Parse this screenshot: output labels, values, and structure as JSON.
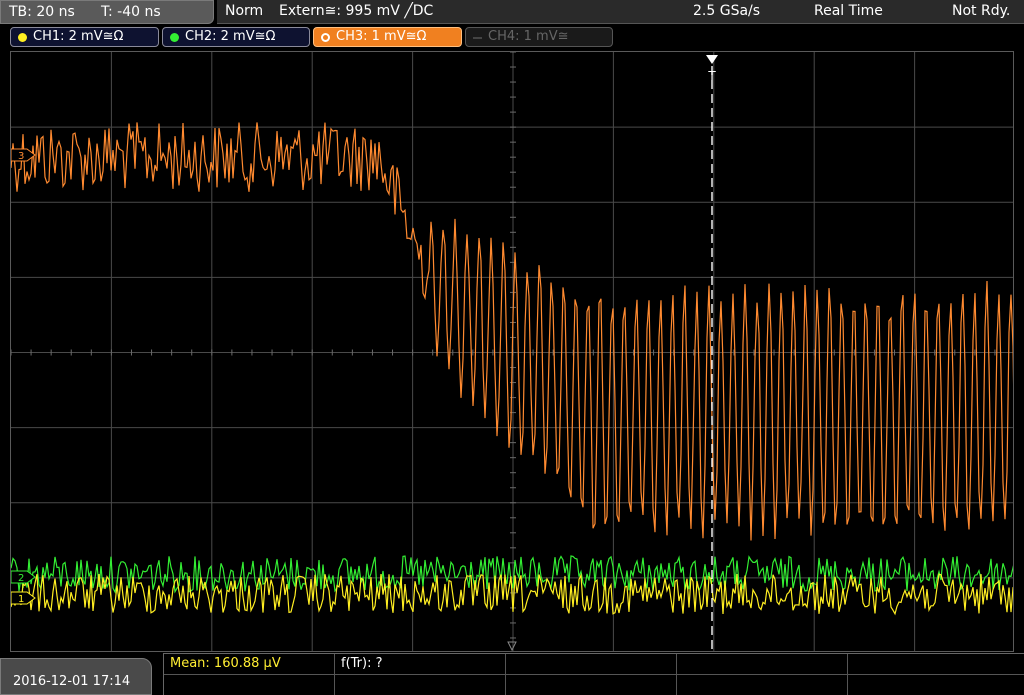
{
  "topbar": {
    "timebase": "TB: 20 ns",
    "trigger_offset": "T: -40 ns",
    "mode": "Norm",
    "trigger_source": "Extern≅: 995 mV ╱DC",
    "sample_rate": "2.5 GSa/s",
    "acq_mode": "Real Time",
    "status": "Not Rdy."
  },
  "channels": [
    {
      "label": "CH1: 2 mV≅Ω",
      "color": "#ffee22",
      "state": "on"
    },
    {
      "label": "CH2: 2 mV≅Ω",
      "color": "#33ee33",
      "state": "on"
    },
    {
      "label": "CH3: 1 mV≅Ω",
      "color": "#ff8a30",
      "state": "active"
    },
    {
      "label": "CH4: 1 mV≅",
      "color": "#666666",
      "state": "off"
    }
  ],
  "markers": {
    "ch3": "3",
    "ch2": "2",
    "ch1": "1",
    "trigger": "T"
  },
  "measurements": {
    "mean_label": "Mean: 160.88 µV",
    "freq_label": "f(Tr): ?"
  },
  "datetime": "2016-12-01 17:14",
  "colors": {
    "ch1": "#ffee22",
    "ch2": "#33ee33",
    "ch3": "#ff8a30",
    "grid": "#4a4a4a",
    "trigger_line": "#ffffff"
  }
}
